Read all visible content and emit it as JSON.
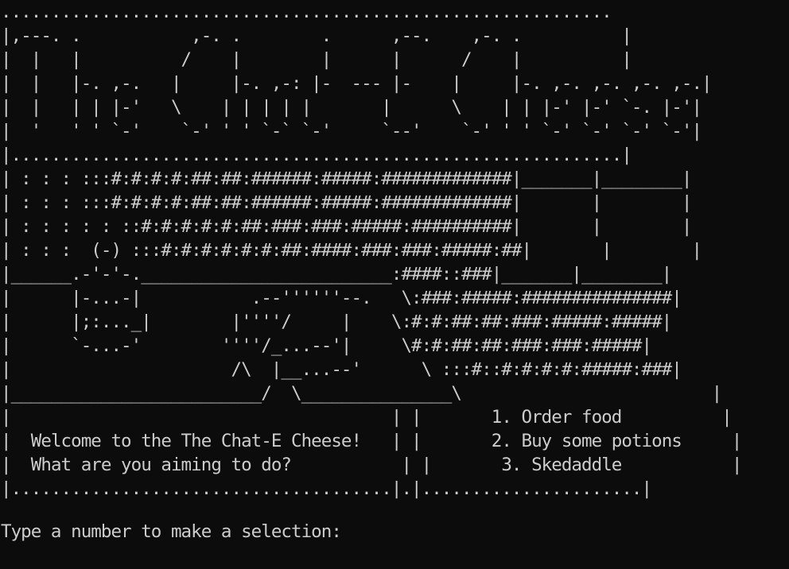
{
  "terminal": {
    "banner_lines": [
      ".............................................................",
      "|,---. .           ,-. .        .      ,--.    ,-. .          |",
      "|  |   |          /    |        |      |      /    |          |",
      "|  |   |-. ,-.   |     |-. ,-: |-  --- |-    |     |-. ,-. ,-. ,-. ,-.|",
      "|  |   | | |-'   \\    | | | | |       |      \\    | | |-' |-' `-. |-'|",
      "|  '   ' ' `-'    `-' ' ' `-` `-'     `--'    `-' ' ' `-' `-' `-' `-'|",
      "|.............................................................|"
    ],
    "scene_lines": [
      "| : : : :::#:#:#:#:##:##:######:#####:#############|_______|________|",
      "| : : : :::#:#:#:#:##:##:######:#####:#############|       |        |",
      "| : : : : : ::#:#:#:#:#:##:###:###:#####:##########|       |        |",
      "| : : :  (-) :::#:#:#:#:#:#:##:####:###:###:#####:##|       |        |",
      "|______.-'-'-._________________________:####::###|_______|________|",
      "|      |-...-|           .--''''''--.   \\:###:#####:###############|",
      "|      |;:..._|        |''''/     |    \\:#:#:##:##:###:#####:#####|",
      "|      `-...-'        ''''/_...--'|     \\#:#:##:##:###:###:#####|",
      "|                      /\\  |__...--'      \\ :::#::#:#:#:#:#####:###|",
      "|_________________________/  \\_______________\\                         |"
    ],
    "welcome_message": "Welcome to the The Chat-E Cheese!",
    "question": "What are you aiming to do?",
    "menu": [
      "1. Order food",
      "2. Buy some potions",
      "3. Skedaddle"
    ],
    "bottom_rule": "|......................................|.|......................|",
    "prompt": "Type a number to make a selection:"
  }
}
